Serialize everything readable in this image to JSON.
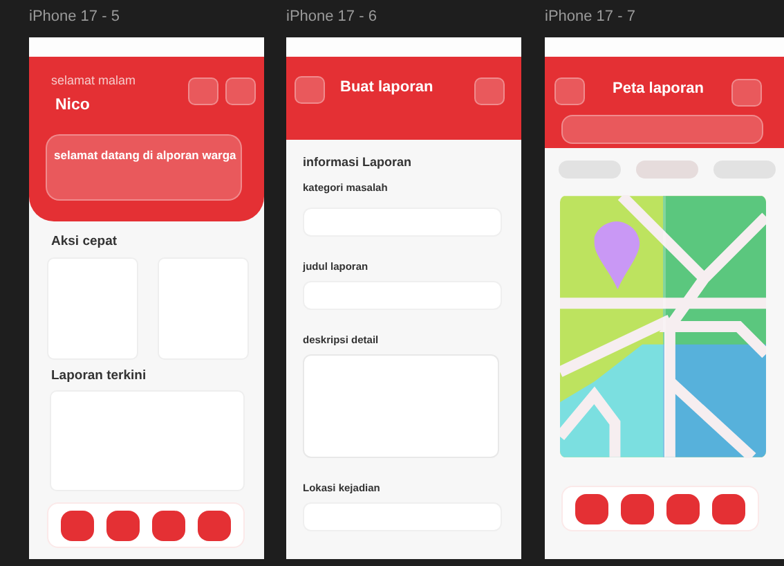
{
  "canvas_frames": [
    {
      "kind": "home",
      "label": "iPhone 17 - 5",
      "greeting": "selamat malam",
      "name": "Nico",
      "banner": "selamat datang di alporan warga",
      "sections": [
        "Aksi cepat",
        "Laporan terkini"
      ]
    },
    {
      "kind": "form",
      "label": "iPhone 17 - 6",
      "title": "Buat laporan",
      "heading": "informasi Laporan",
      "fields": [
        {
          "label": "kategori masalah",
          "kind": "input"
        },
        {
          "label": "judul laporan",
          "kind": "input"
        },
        {
          "label": "deskripsi detail",
          "kind": "textarea"
        },
        {
          "label": "Lokasi kejadian",
          "kind": "input"
        }
      ]
    },
    {
      "kind": "map",
      "label": "iPhone 17 - 7",
      "title": "Peta laporan"
    }
  ]
}
